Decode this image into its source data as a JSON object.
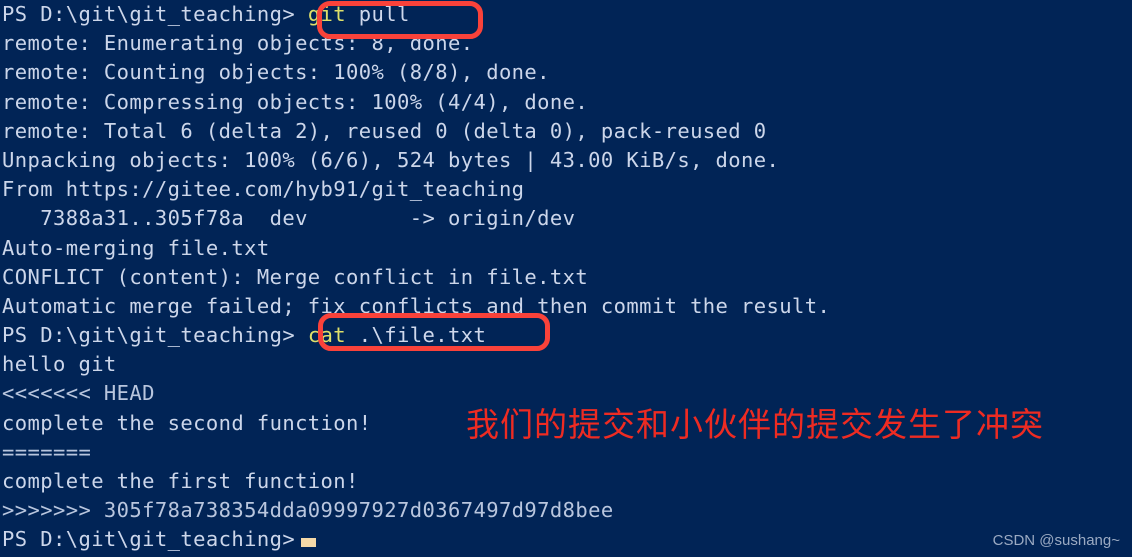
{
  "terminal": {
    "background_color": "#012456",
    "text_color": "#ccd6ea",
    "command_color": "#dfe06a",
    "annotation_color": "#ee2b22",
    "box_color": "#f9423a",
    "cursor_color": "#f5d9a8",
    "lines": [
      {
        "id": "line-1-prompt-git-pull",
        "segments": [
          {
            "cls": "c-prompt",
            "text": "PS D:\\git\\git_teaching> "
          },
          {
            "cls": "c-cmd",
            "text": "git"
          },
          {
            "cls": "c-arg",
            "text": " pull"
          }
        ]
      },
      {
        "id": "line-2-enumerating",
        "segments": [
          {
            "cls": "c-default",
            "text": "remote: Enumerating objects: 8, done."
          }
        ]
      },
      {
        "id": "line-3-counting",
        "segments": [
          {
            "cls": "c-default",
            "text": "remote: Counting objects: 100% (8/8), done."
          }
        ]
      },
      {
        "id": "line-4-compressing",
        "segments": [
          {
            "cls": "c-default",
            "text": "remote: Compressing objects: 100% (4/4), done."
          }
        ]
      },
      {
        "id": "line-5-total",
        "segments": [
          {
            "cls": "c-default",
            "text": "remote: Total 6 (delta 2), reused 0 (delta 0), pack-reused 0"
          }
        ]
      },
      {
        "id": "line-6-unpacking",
        "segments": [
          {
            "cls": "c-default",
            "text": "Unpacking objects: 100% (6/6), 524 bytes | 43.00 KiB/s, done."
          }
        ]
      },
      {
        "id": "line-7-from",
        "segments": [
          {
            "cls": "c-default",
            "text": "From https://gitee.com/hyb91/git_teaching"
          }
        ]
      },
      {
        "id": "line-8-refupdate",
        "segments": [
          {
            "cls": "c-default",
            "text": "   7388a31..305f78a  dev        -> origin/dev"
          }
        ]
      },
      {
        "id": "line-9-automerging",
        "segments": [
          {
            "cls": "c-default",
            "text": "Auto-merging file.txt"
          }
        ]
      },
      {
        "id": "line-10-conflict",
        "segments": [
          {
            "cls": "c-default",
            "text": "CONFLICT (content): Merge conflict in file.txt"
          }
        ]
      },
      {
        "id": "line-11-autofailed",
        "segments": [
          {
            "cls": "c-default",
            "text": "Automatic merge failed; fix conflicts and then commit the result."
          }
        ]
      },
      {
        "id": "line-12-prompt-cat",
        "segments": [
          {
            "cls": "c-prompt",
            "text": "PS D:\\git\\git_teaching> "
          },
          {
            "cls": "c-cmd",
            "text": "cat"
          },
          {
            "cls": "c-arg",
            "text": " .\\file.txt"
          }
        ]
      },
      {
        "id": "line-13-hello-git",
        "segments": [
          {
            "cls": "c-default",
            "text": "hello git"
          }
        ]
      },
      {
        "id": "line-14-head-marker",
        "segments": [
          {
            "cls": "c-marker",
            "text": "<<<<<<< HEAD"
          }
        ]
      },
      {
        "id": "line-15-second-function",
        "segments": [
          {
            "cls": "c-default",
            "text": "complete the second function!"
          }
        ]
      },
      {
        "id": "line-16-equals-marker",
        "segments": [
          {
            "cls": "c-marker",
            "text": "======="
          }
        ]
      },
      {
        "id": "line-17-first-function",
        "segments": [
          {
            "cls": "c-default",
            "text": "complete the first function!"
          }
        ]
      },
      {
        "id": "line-18-theirs-marker",
        "segments": [
          {
            "cls": "c-marker",
            "text": ">>>>>>> 305f78a738354dda09997927d0367497d97d8bee"
          }
        ]
      },
      {
        "id": "line-19-prompt-final",
        "segments": [
          {
            "cls": "c-prompt",
            "text": "PS D:\\git\\git_teaching>"
          }
        ],
        "cursor": true
      }
    ]
  },
  "annotations": {
    "chinese_note": "我们的提交和小伙伴的提交发生了冲突",
    "highlight_git_pull": "git pull",
    "highlight_cat_file": "cat .\\file.txt"
  },
  "watermark": {
    "text": "CSDN @sushang~"
  }
}
